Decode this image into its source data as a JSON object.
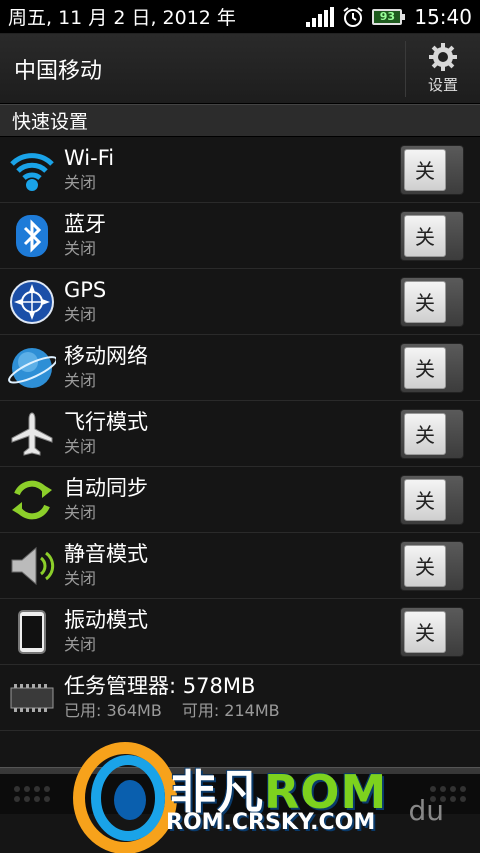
{
  "status_bar": {
    "date": "周五, 11 月 2 日, 2012 年",
    "battery": "93",
    "time": "15:40"
  },
  "header": {
    "operator": "中国移动",
    "settings_label": "设置"
  },
  "quick_settings": {
    "title": "快速设置",
    "items": [
      {
        "title": "Wi-Fi",
        "status": "关闭",
        "toggle": "关",
        "icon": "wifi-icon"
      },
      {
        "title": "蓝牙",
        "status": "关闭",
        "toggle": "关",
        "icon": "bluetooth-icon"
      },
      {
        "title": "GPS",
        "status": "关闭",
        "toggle": "关",
        "icon": "gps-icon"
      },
      {
        "title": "移动网络",
        "status": "关闭",
        "toggle": "关",
        "icon": "mobile-network-icon"
      },
      {
        "title": "飞行模式",
        "status": "关闭",
        "toggle": "关",
        "icon": "airplane-icon"
      },
      {
        "title": "自动同步",
        "status": "关闭",
        "toggle": "关",
        "icon": "sync-icon"
      },
      {
        "title": "静音模式",
        "status": "关闭",
        "toggle": "关",
        "icon": "speaker-icon"
      },
      {
        "title": "振动模式",
        "status": "关闭",
        "toggle": "关",
        "icon": "vibrate-phone-icon"
      }
    ],
    "task_manager": {
      "title": "任务管理器: 578MB",
      "used": "已用: 364MB",
      "free": "可用: 214MB",
      "icon": "memory-chip-icon"
    }
  },
  "watermark": {
    "brand_cn": "非凡",
    "brand_en": "ROM",
    "url": "ROM.CRSKY.COM",
    "du": "du"
  },
  "colors": {
    "accent_green": "#7dd21e",
    "wifi_blue": "#1aa3e8",
    "sync_green": "#8ccf2a"
  }
}
